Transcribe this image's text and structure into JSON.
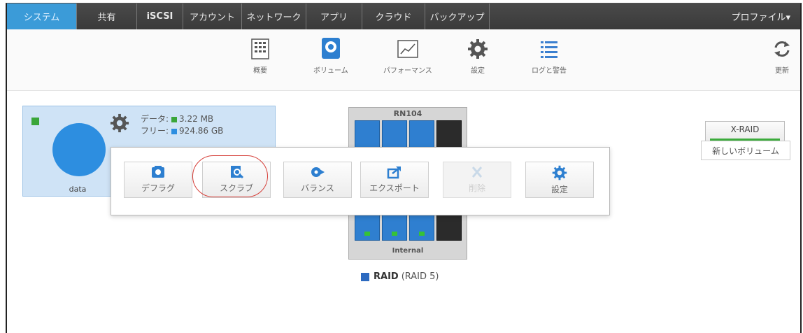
{
  "nav": {
    "tabs": [
      {
        "label": "システム",
        "active": true,
        "width": 100
      },
      {
        "label": "共有",
        "active": false,
        "width": 86
      },
      {
        "label": "iSCSI",
        "active": false,
        "width": 66
      },
      {
        "label": "アカウント",
        "active": false,
        "width": 84
      },
      {
        "label": "ネットワーク",
        "active": false,
        "width": 92
      },
      {
        "label": "アプリ",
        "active": false,
        "width": 80
      },
      {
        "label": "クラウド",
        "active": false,
        "width": 90
      },
      {
        "label": "バックアップ",
        "active": false,
        "width": 92
      }
    ],
    "profile_label": "プロファイル▾"
  },
  "toolbar": {
    "summary": "概要",
    "volume": "ボリューム",
    "performance": "パフォーマンス",
    "settings": "設定",
    "logs": "ログと警告",
    "refresh": "更新"
  },
  "volume": {
    "name": "data",
    "data_label": "データ:",
    "data_value": "3.22 MB",
    "free_label": "フリー:",
    "free_value": "924.86 GB"
  },
  "device": {
    "model": "RN104",
    "location": "Internal"
  },
  "raid": {
    "label": "RAID",
    "level": "(RAID 5)"
  },
  "right": {
    "xraid_label": "X-RAID",
    "new_volume": "新しいボリューム"
  },
  "popup": {
    "defrag": "デフラグ",
    "scrub": "スクラブ",
    "balance": "バランス",
    "export": "エクスポート",
    "delete": "削除",
    "settings": "設定"
  },
  "colors": {
    "accent": "#3b9bd8",
    "volume_blue": "#2d8ee0",
    "status_green": "#3aa63a",
    "highlight_red": "#d6403a"
  }
}
